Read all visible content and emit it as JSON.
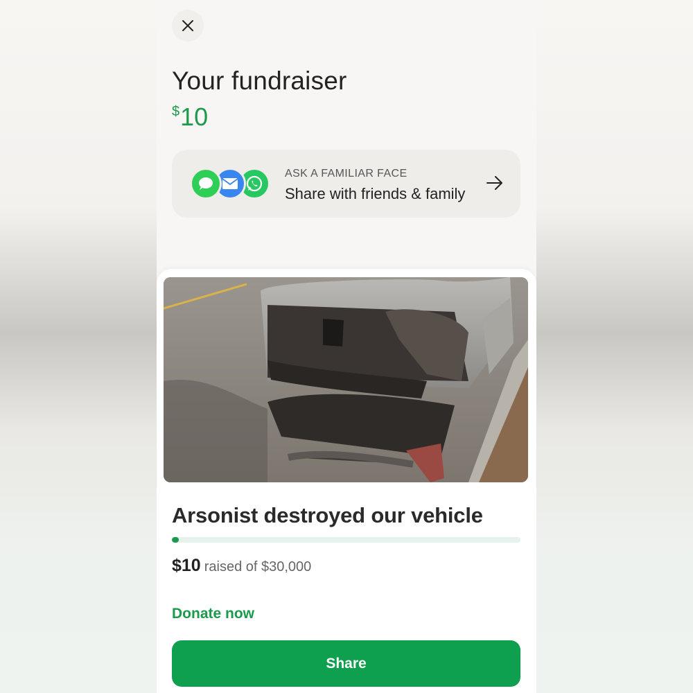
{
  "header": {
    "close_icon": "close-icon",
    "title": "Your fundraiser",
    "amount_symbol": "$",
    "amount_value": "10"
  },
  "share_card": {
    "icons": [
      "messages-icon",
      "mail-icon",
      "whatsapp-icon"
    ],
    "eyebrow": "ASK A FAMILIAR FACE",
    "label": "Share with friends & family",
    "arrow_icon": "arrow-right-icon"
  },
  "fundraiser": {
    "photo_description": "burned-car-photo",
    "title": "Arsonist destroyed our vehicle",
    "raised_amount": "$10",
    "raised_suffix": "raised of $30,000",
    "progress_fraction": 0.00033,
    "donate_label": "Donate now",
    "share_label": "Share"
  },
  "colors": {
    "brand_green": "#1b9a4c",
    "button_green": "#0e9f4f",
    "progress_track": "#e6f2ec"
  }
}
